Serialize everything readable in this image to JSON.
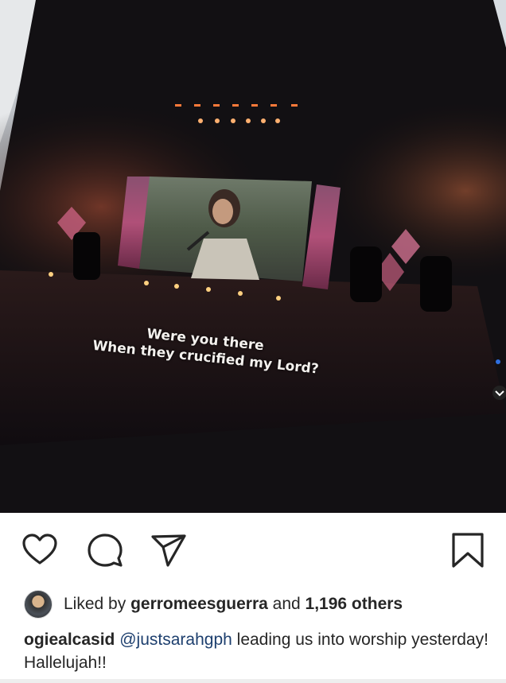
{
  "post": {
    "lyrics": {
      "line1": "Were you there",
      "line2": "When they crucified my Lord?"
    }
  },
  "actions": {
    "like_icon": "heart-icon",
    "comment_icon": "comment-icon",
    "share_icon": "paper-plane-icon",
    "save_icon": "bookmark-icon"
  },
  "likes": {
    "prefix": "Liked by",
    "user": "gerromeesguerra",
    "conjunction": "and",
    "count": "1,196 others"
  },
  "caption": {
    "username": "ogiealcasid",
    "mention": "@justsarahgph",
    "text": "leading us into worship yesterday! Hallelujah!!"
  },
  "colors": {
    "text": "#262626",
    "mention": "#1d3f6e",
    "background": "#ffffff"
  }
}
